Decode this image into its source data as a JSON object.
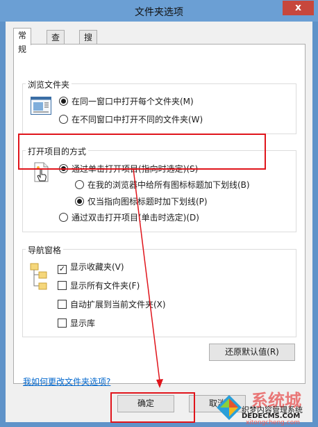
{
  "window": {
    "title": "文件夹选项",
    "close_label": "x"
  },
  "tabs": [
    {
      "label": "常规"
    },
    {
      "label": "查看"
    },
    {
      "label": "搜索"
    }
  ],
  "browse_folders": {
    "title": "浏览文件夹",
    "options": [
      {
        "label": "在同一窗口中打开每个文件夹(M)",
        "selected": true
      },
      {
        "label": "在不同窗口中打开不同的文件夹(W)",
        "selected": false
      }
    ]
  },
  "open_items": {
    "title": "打开项目的方式",
    "single_click": "通过单击打开项目(指向时选定)(S)",
    "underline_all": "在我的浏览器中给所有图标标题加下划线(B)",
    "underline_hover": "仅当指向图标标题时加下划线(P)",
    "double_click": "通过双击打开项目(单击时选定)(D)"
  },
  "nav_pane": {
    "title": "导航窗格",
    "options": [
      {
        "label": "显示收藏夹(V)",
        "checked": true
      },
      {
        "label": "显示所有文件夹(F)",
        "checked": false
      },
      {
        "label": "自动扩展到当前文件夹(X)",
        "checked": false
      },
      {
        "label": "显示库",
        "checked": false
      }
    ]
  },
  "restore_defaults": "还原默认值(R)",
  "help_link": "我如何更改文件夹选项?",
  "footer": {
    "ok": "确定",
    "cancel": "取消"
  },
  "watermark": {
    "line1": "织梦内容管理系统",
    "line2": "DEDECMS.COM",
    "line3": "xitongcheng.com",
    "brand": "系统城"
  },
  "colors": {
    "annotation_red": "#e0141b",
    "link_blue": "#0066cc",
    "title_bar": "#6b9fd4"
  }
}
